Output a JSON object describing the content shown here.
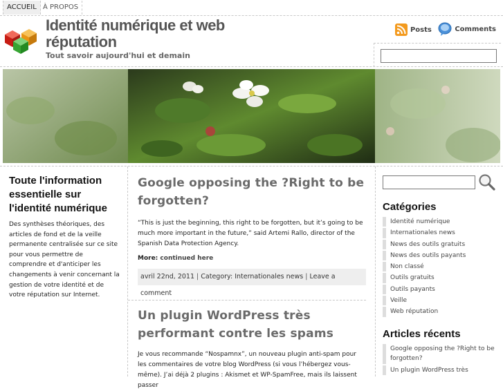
{
  "nav": {
    "items": [
      "ACCUEIL",
      "À PROPOS"
    ]
  },
  "header": {
    "title": "Identité numérique et web réputation",
    "tagline": "Tout savoir aujourd'hui et demain",
    "feeds": {
      "posts": "Posts",
      "comments": "Comments"
    },
    "search_value": ""
  },
  "intro": {
    "title": "Toute l'information essentielle sur l'identité numérique",
    "text": "Des synthèses théoriques, des articles de fond et de la veille permanente centralisée sur ce site pour vous permettre de comprendre et d'anticiper les changements à venir concernant la gestion de votre identité et de votre réputation sur Internet."
  },
  "posts": [
    {
      "title": "Google opposing the ?Right to be forgotten?",
      "body": "“This is just the beginning, this right to be forgotten, but it’s going to be much more important in the future,” said Artemi Rallo, director of the Spanish Data Protection Agency.",
      "more_label": "More:",
      "more_link": "continued here",
      "date": "avril 22nd, 2011",
      "category_label": "Category:",
      "category": "Internationales news",
      "comment_link": "Leave a comment"
    },
    {
      "title": "Un plugin WordPress très performant contre les spams",
      "body": "Je vous recommande “Nospamnx”, un nouveau plugin anti-spam pour les commentaires de votre blog WordPress (si vous l’hébergez vous-même). J’ai déjà 2 plugins : Akismet et WP-SpamFree, mais ils laissent passer"
    }
  ],
  "sidebar": {
    "search_value": "",
    "categories_title": "Catégories",
    "categories": [
      "Identité numérique",
      "Internationales news",
      "News des outils gratuits",
      "News des outils payants",
      "Non classé",
      "Outils gratuits",
      "Outils payants",
      "Veille",
      "Web réputation"
    ],
    "recent_title": "Articles récents",
    "recent": [
      "Google opposing the ?Right to be forgotten?",
      "Un plugin WordPress très"
    ]
  },
  "colors": {
    "rss": "#f39a1e",
    "comments": "#4a90d9",
    "logo_red": "#d9261c",
    "logo_green": "#3aa63a",
    "logo_orange": "#f2a21a"
  }
}
